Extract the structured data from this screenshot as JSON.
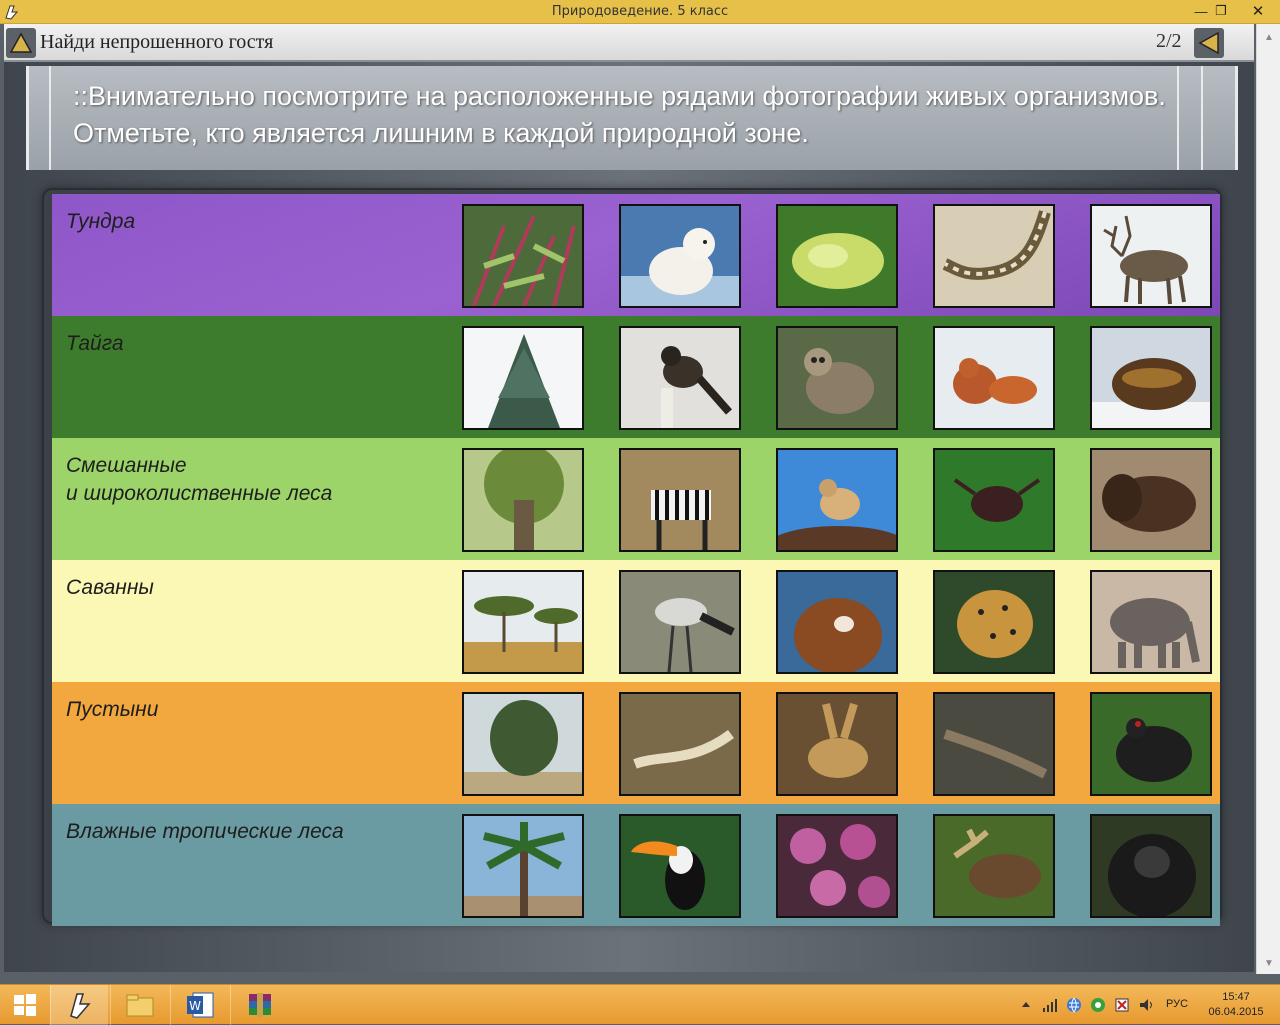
{
  "window": {
    "title": "Природоведение. 5 класс"
  },
  "header": {
    "heading": "Найди непрошенного гостя",
    "page_indicator": "2/2"
  },
  "instruction": "::Внимательно посмотрите на расположенные рядами фотографии живых организмов. Отметьте, кто является лишним в каждой природной зоне.",
  "zones": [
    {
      "name": "Тундра",
      "photos": [
        "tundra-shrub",
        "arctic-fox",
        "moss-lichen",
        "snake",
        "reindeer"
      ]
    },
    {
      "name": "Тайга",
      "photos": [
        "spruce-tree",
        "nutcracker-bird",
        "sloth",
        "squirrel",
        "wolverine"
      ]
    },
    {
      "name": "Смешанные\nи широколиственные леса",
      "photos": [
        "oak-tree",
        "zebra",
        "bird-on-rock",
        "stag-beetle",
        "bison"
      ]
    },
    {
      "name": "Саванны",
      "photos": [
        "acacia-trees",
        "secretary-bird",
        "brown-bear",
        "leopard",
        "elephant"
      ]
    },
    {
      "name": "Пустыни",
      "photos": [
        "saxaul-shrub",
        "monitor-lizard",
        "jerboa",
        "lizard",
        "capercaillie"
      ]
    },
    {
      "name": "Влажные тропические леса",
      "photos": [
        "palm-tree",
        "toucan",
        "orchids",
        "moose",
        "gorilla"
      ]
    }
  ],
  "taskbar": {
    "language": "РУС",
    "time": "15:47",
    "date": "06.04.2015"
  }
}
